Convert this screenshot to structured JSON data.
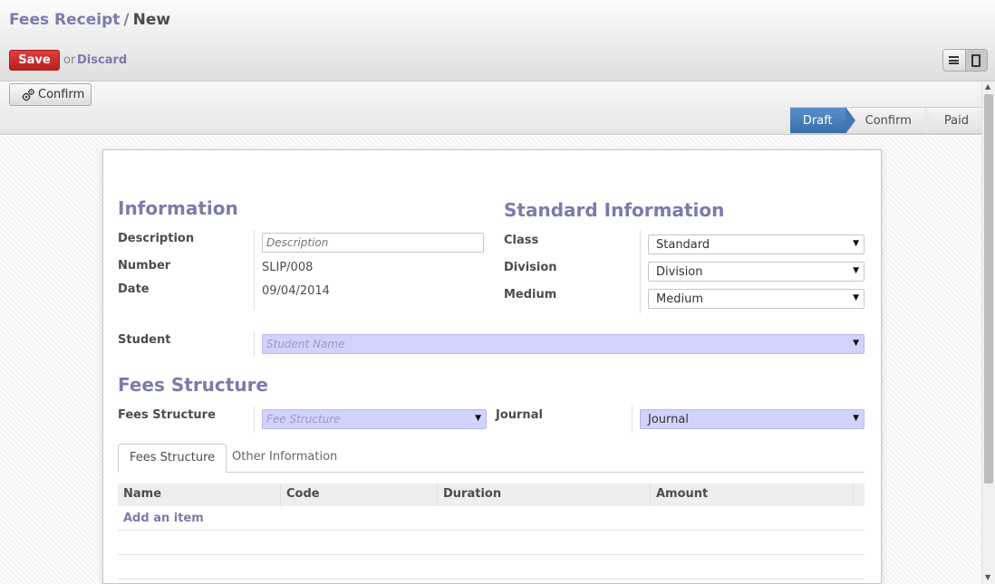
{
  "breadcrumb": {
    "parent": "Fees Receipt",
    "separator": "/",
    "current": "New"
  },
  "actions": {
    "save_label": "Save",
    "or_label": "or",
    "discard_label": "Discard"
  },
  "view_switch": {
    "list_icon": "list-view-icon",
    "form_icon": "form-view-icon"
  },
  "statusbar": {
    "confirm_button": "Confirm",
    "confirm_icon": "gears-icon",
    "steps": [
      {
        "label": "Draft",
        "active": true
      },
      {
        "label": "Confirm",
        "active": false
      },
      {
        "label": "Paid",
        "active": false
      }
    ]
  },
  "information": {
    "title": "Information",
    "description_label": "Description",
    "description_placeholder": "Description",
    "number_label": "Number",
    "number_value": "SLIP/008",
    "date_label": "Date",
    "date_value": "09/04/2014"
  },
  "standard_information": {
    "title": "Standard Information",
    "class_label": "Class",
    "class_value": "Standard",
    "division_label": "Division",
    "division_value": "Division",
    "medium_label": "Medium",
    "medium_value": "Medium"
  },
  "student": {
    "label": "Student",
    "placeholder": "Student Name"
  },
  "fees_structure": {
    "title": "Fees Structure",
    "label": "Fees Structure",
    "placeholder": "Fee Structure",
    "journal_label": "Journal",
    "journal_value": "Journal"
  },
  "tabs": [
    {
      "label": "Fees Structure",
      "active": true
    },
    {
      "label": "Other Information",
      "active": false
    }
  ],
  "grid": {
    "columns": [
      "Name",
      "Code",
      "Duration",
      "Amount"
    ],
    "add_item": "Add an item"
  },
  "colors": {
    "accent": "#7c7bad",
    "save": "#c92a2a",
    "active_step": "#4577b2",
    "required_field": "#d2d2ff"
  }
}
